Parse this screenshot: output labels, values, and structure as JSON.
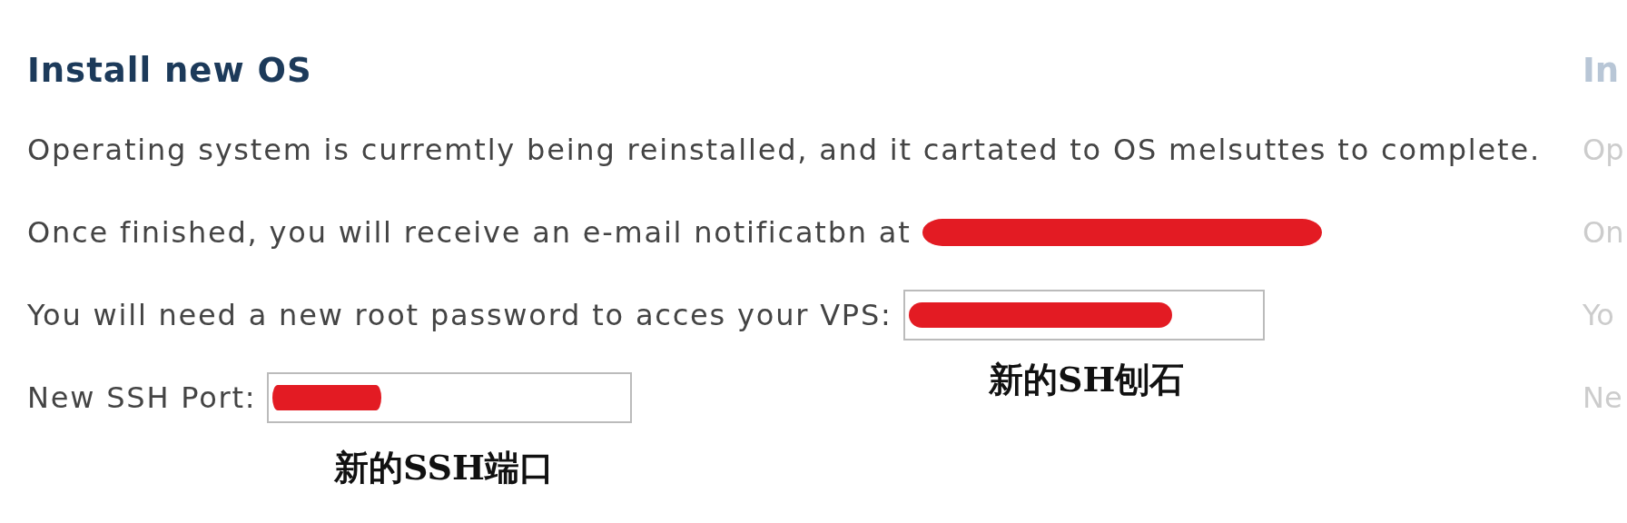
{
  "panel": {
    "title": "Install new OS",
    "status_text": "Operating system is curremtly being reinstalled, and it cartated to OS melsuttes to complete.",
    "email_text": "Once finished, you will receive an e-mail notificatbn at",
    "password_label": "You will need a new root password to acces your VPS:",
    "ssh_port_label": "New SSH Port:"
  },
  "annotations": {
    "password": "新的SH刨石",
    "ssh_port": "新的SSH端口"
  },
  "ghost_panel": {
    "title": "In",
    "lines": [
      "Op",
      "On",
      "Yo",
      "Ne"
    ]
  }
}
